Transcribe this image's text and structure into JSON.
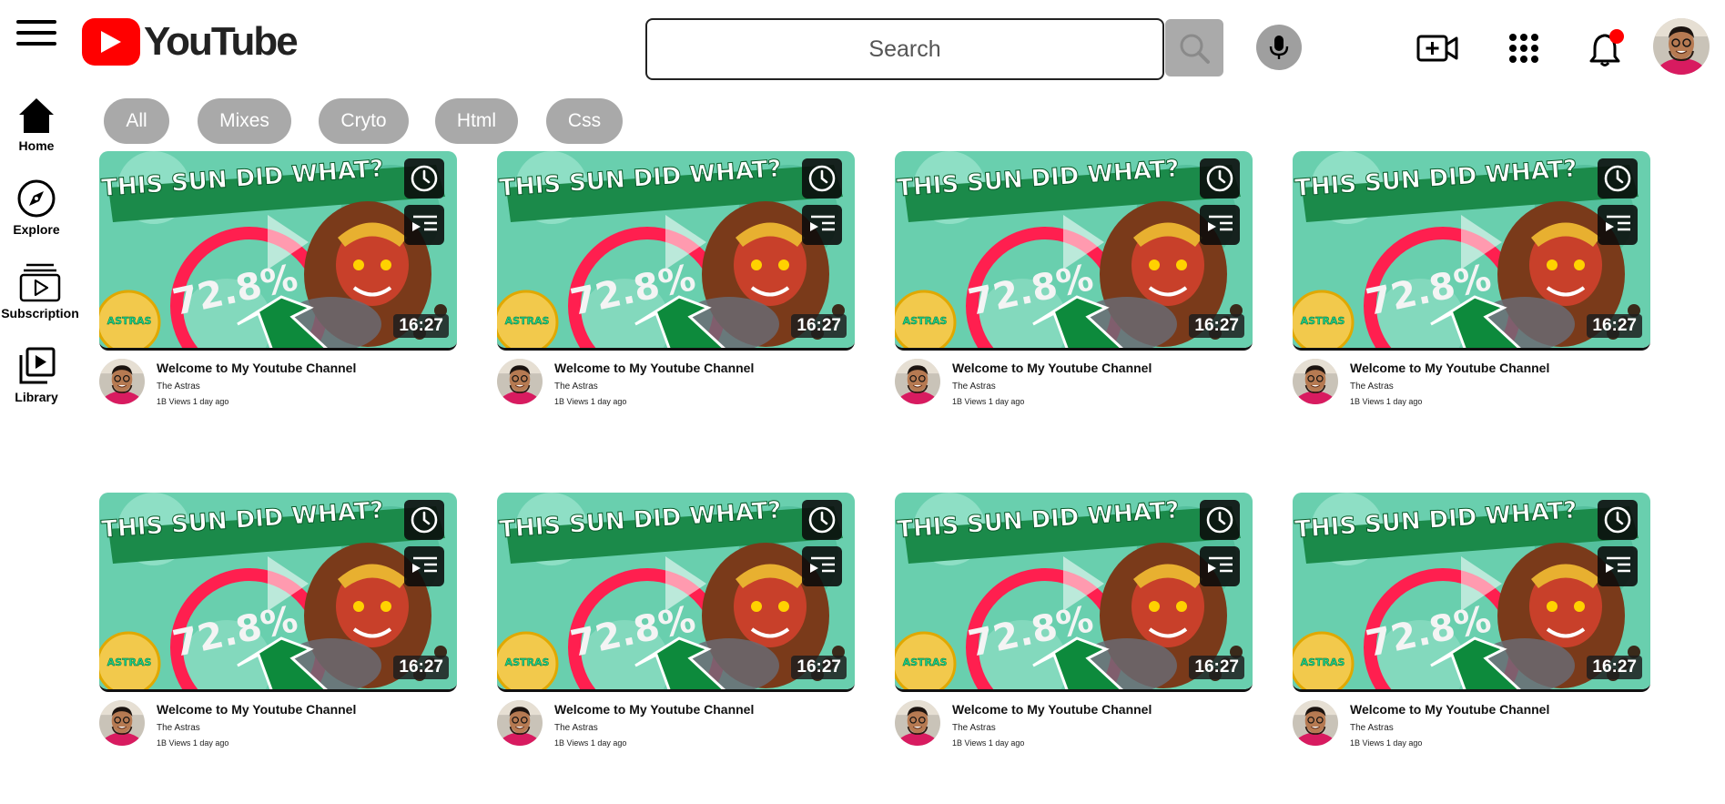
{
  "header": {
    "logo_text": "YouTube",
    "search_placeholder": "Search",
    "icons": [
      "menu-icon",
      "search-icon",
      "microphone-icon",
      "create-video-icon",
      "apps-grid-icon",
      "notification-bell-icon",
      "profile-avatar"
    ],
    "notification_dot_color": "#ff0000",
    "brand_color": "#ff0000"
  },
  "sidebar": {
    "items": [
      {
        "label": "Home",
        "icon": "home-icon"
      },
      {
        "label": "Explore",
        "icon": "compass-icon"
      },
      {
        "label": "Subscription",
        "icon": "subscriptions-icon"
      },
      {
        "label": "Library",
        "icon": "library-icon"
      }
    ]
  },
  "chips": [
    {
      "label": "All"
    },
    {
      "label": "Mixes"
    },
    {
      "label": "Cryto"
    },
    {
      "label": "Html"
    },
    {
      "label": "Css"
    }
  ],
  "videos": [
    {
      "title": "Welcome to My Youtube Channel",
      "channel": "The Astras",
      "stats": "1B Views 1 day ago",
      "duration": "16:27",
      "thumb_headline": "THIS SUN DID WHAT?",
      "thumb_percent": "72.8%",
      "thumb_badge": "ASTRAS"
    },
    {
      "title": "Welcome to My Youtube Channel",
      "channel": "The Astras",
      "stats": "1B Views 1 day ago",
      "duration": "16:27",
      "thumb_headline": "THIS SUN DID WHAT?",
      "thumb_percent": "72.8%",
      "thumb_badge": "ASTRAS"
    },
    {
      "title": "Welcome to My Youtube Channel",
      "channel": "The Astras",
      "stats": "1B Views 1 day ago",
      "duration": "16:27",
      "thumb_headline": "THIS SUN DID WHAT?",
      "thumb_percent": "72.8%",
      "thumb_badge": "ASTRAS"
    },
    {
      "title": "Welcome to My Youtube Channel",
      "channel": "The Astras",
      "stats": "1B Views 1 day ago",
      "duration": "16:27",
      "thumb_headline": "THIS SUN DID WHAT?",
      "thumb_percent": "72.8%",
      "thumb_badge": "ASTRAS"
    },
    {
      "title": "Welcome to My Youtube Channel",
      "channel": "The Astras",
      "stats": "1B Views 1 day ago",
      "duration": "16:27",
      "thumb_headline": "THIS SUN DID WHAT?",
      "thumb_percent": "72.8%",
      "thumb_badge": "ASTRAS"
    },
    {
      "title": "Welcome to My Youtube Channel",
      "channel": "The Astras",
      "stats": "1B Views 1 day ago",
      "duration": "16:27",
      "thumb_headline": "THIS SUN DID WHAT?",
      "thumb_percent": "72.8%",
      "thumb_badge": "ASTRAS"
    },
    {
      "title": "Welcome to My Youtube Channel",
      "channel": "The Astras",
      "stats": "1B Views 1 day ago",
      "duration": "16:27",
      "thumb_headline": "THIS SUN DID WHAT?",
      "thumb_percent": "72.8%",
      "thumb_badge": "ASTRAS"
    },
    {
      "title": "Welcome to My Youtube Channel",
      "channel": "The Astras",
      "stats": "1B Views 1 day ago",
      "duration": "16:27",
      "thumb_headline": "THIS SUN DID WHAT?",
      "thumb_percent": "72.8%",
      "thumb_badge": "ASTRAS"
    }
  ]
}
